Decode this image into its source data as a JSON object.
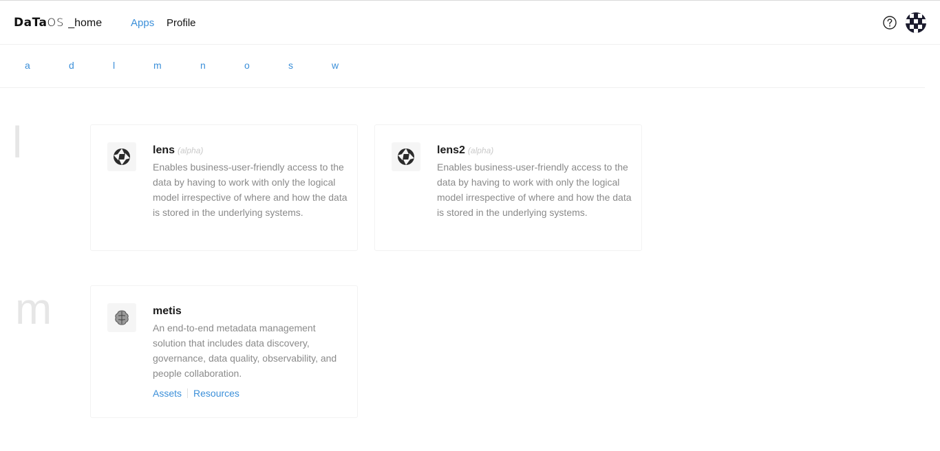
{
  "header": {
    "logo_data": "DaTa",
    "logo_os": "OS",
    "logo_home": "_home",
    "nav": [
      {
        "label": "Apps",
        "active": true
      },
      {
        "label": "Profile",
        "active": false
      }
    ],
    "help_icon": "question-circle-icon",
    "avatar_icon": "user-avatar"
  },
  "alphabet": [
    "a",
    "d",
    "l",
    "m",
    "n",
    "o",
    "s",
    "w"
  ],
  "sections": [
    {
      "letter": "l",
      "cards": [
        {
          "title": "lens",
          "badge": "(alpha)",
          "icon": "aperture-icon",
          "description": "Enables business-user-friendly access to the data by having to work with only the logical model irrespective of where and how the data is stored in the underlying systems."
        },
        {
          "title": "lens2",
          "badge": "(alpha)",
          "icon": "aperture-icon",
          "description": "Enables business-user-friendly access to the data by having to work with only the logical model irrespective of where and how the data is stored in the underlying systems."
        }
      ]
    },
    {
      "letter": "m",
      "cards": [
        {
          "title": "metis",
          "icon": "brain-icon",
          "description": "An end-to-end metadata management solution that includes data discovery, governance, data quality, observability, and people collaboration.",
          "links": [
            "Assets",
            "Resources"
          ]
        }
      ]
    }
  ],
  "colors": {
    "accent": "#3b8fd9",
    "text_muted": "#8a8a8a",
    "section_letter": "#e6e6e6"
  }
}
